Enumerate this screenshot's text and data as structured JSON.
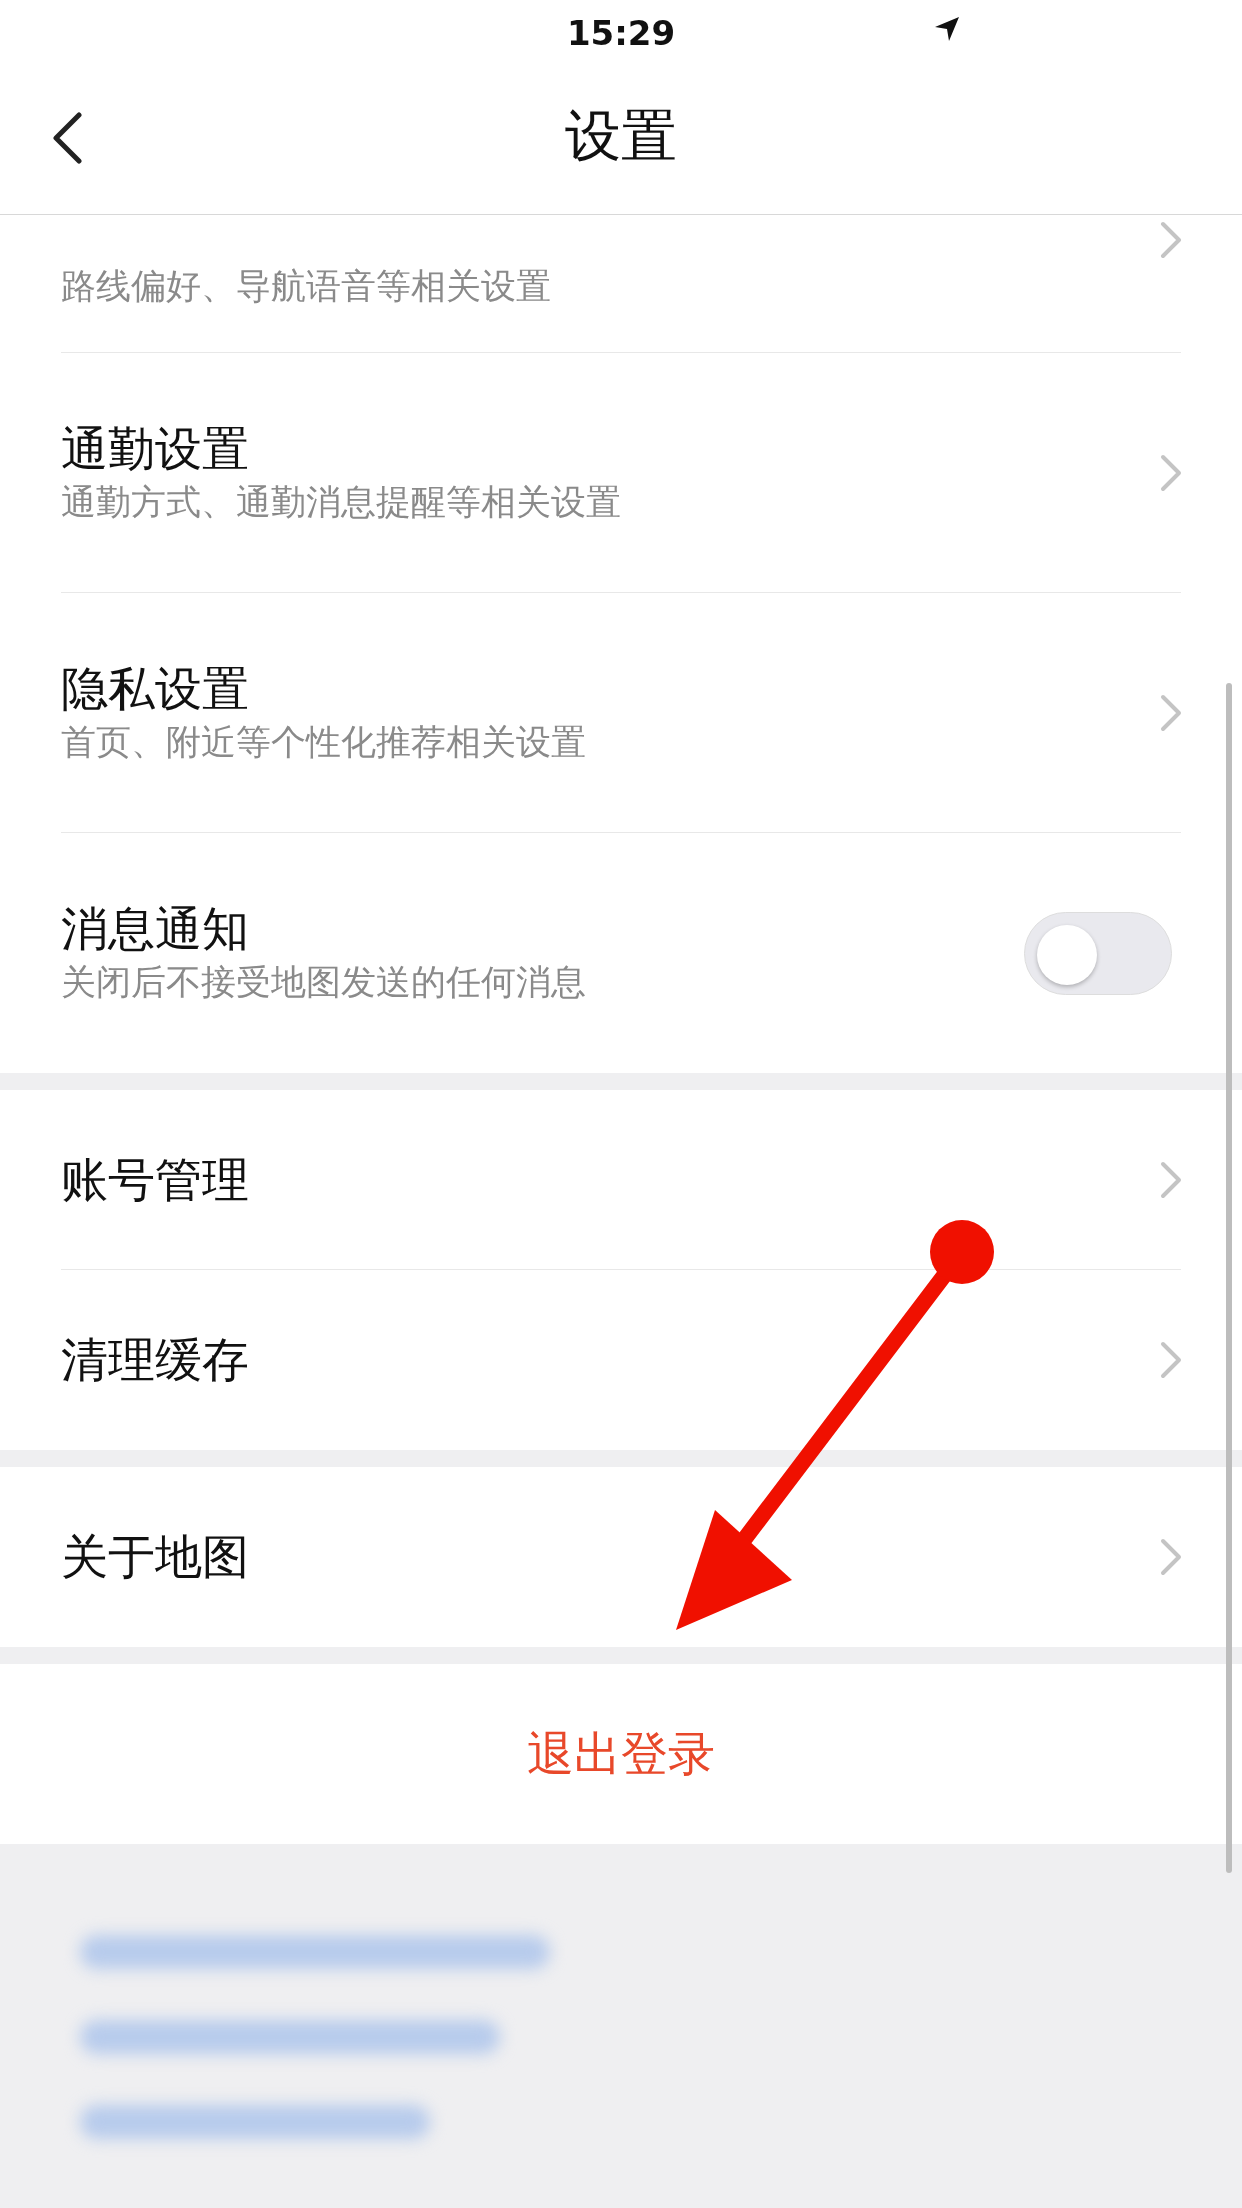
{
  "status_bar": {
    "time": "15:29"
  },
  "nav": {
    "title": "设置"
  },
  "sections": [
    {
      "items": [
        {
          "kind": "link",
          "subtitle": "路线偏好、导航语音等相关设置"
        },
        {
          "kind": "link",
          "title": "通勤设置",
          "subtitle": "通勤方式、通勤消息提醒等相关设置"
        },
        {
          "kind": "link",
          "title": "隐私设置",
          "subtitle": "首页、附近等个性化推荐相关设置"
        },
        {
          "kind": "toggle",
          "title": "消息通知",
          "subtitle": "关闭后不接受地图发送的任何消息",
          "on": false
        }
      ]
    },
    {
      "items": [
        {
          "kind": "link",
          "title": "账号管理"
        },
        {
          "kind": "link",
          "title": "清理缓存"
        }
      ]
    },
    {
      "items": [
        {
          "kind": "link",
          "title": "关于地图"
        }
      ]
    }
  ],
  "logout": {
    "label": "退出登录"
  }
}
